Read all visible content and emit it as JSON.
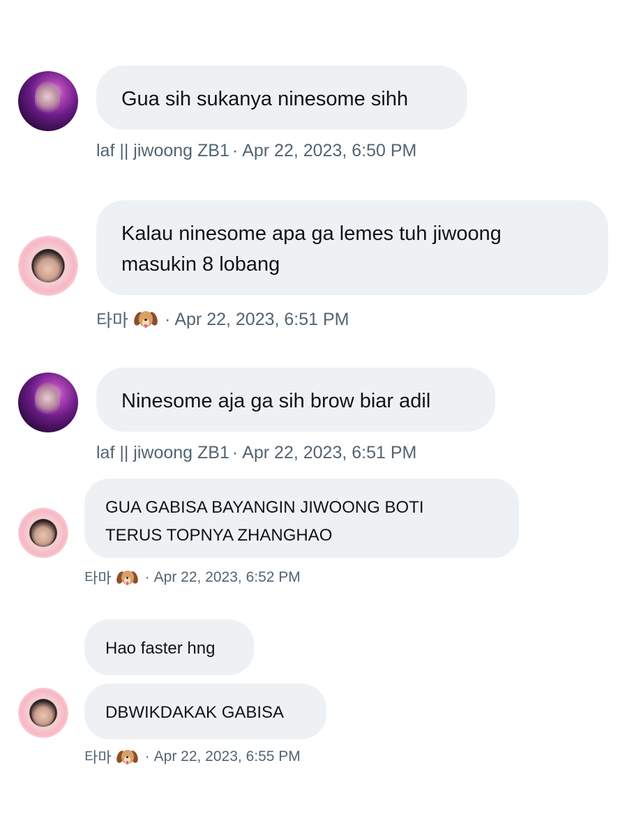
{
  "messages": [
    {
      "sender": "laf || jiwoong ZB1",
      "text": "Gua sih sukanya ninesome sihh",
      "time": "Apr 22, 2023, 6:50 PM"
    },
    {
      "sender": "타마",
      "text": "Kalau ninesome apa ga lemes tuh jiwoong\nmasukin 8 lobang",
      "time": "Apr 22, 2023, 6:51 PM"
    },
    {
      "sender": "laf || jiwoong ZB1",
      "text": "Ninesome aja ga sih brow biar adil",
      "time": "Apr 22, 2023, 6:51 PM"
    },
    {
      "sender": "타마",
      "text": "GUA GABISA BAYANGIN JIWOONG BOTI\nTERUS TOPNYA ZHANGHAO",
      "time": "Apr 22, 2023, 6:52 PM"
    },
    {
      "sender": "",
      "text": "Hao faster hng",
      "time": ""
    },
    {
      "sender": "타마",
      "text": "DBWIKDAKAK GABISA",
      "time": "Apr 22, 2023, 6:55 PM"
    }
  ],
  "separator": "·",
  "sender_emoji": "dog-face-icon",
  "colors": {
    "bubble": "#eef1f4",
    "meta_text": "#536471",
    "message_text": "#0f1419"
  }
}
